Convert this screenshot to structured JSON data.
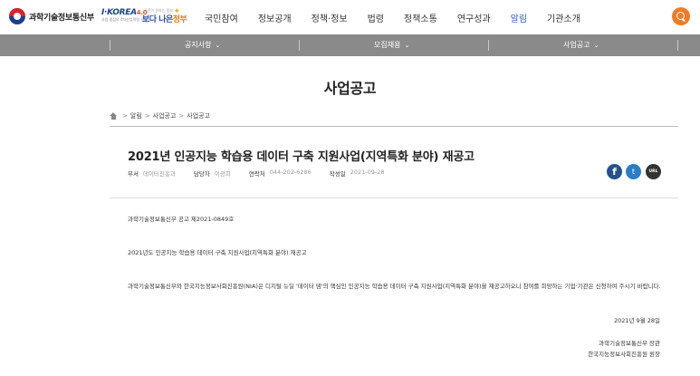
{
  "header": {
    "org_name": "과학기술정보통신부",
    "korea_logo": "I·KOREA",
    "korea_logo_suffix": "4.0",
    "korea_logo_sub": "사람 중심의 4차산업혁명 선도",
    "policy_logo_top": "국민이 원하는 정부",
    "policy_logo_prefix": "보다 나은",
    "policy_logo_main": "정부",
    "nav": [
      {
        "label": "국민참여"
      },
      {
        "label": "정보공개"
      },
      {
        "label": "정책·정보"
      },
      {
        "label": "법령"
      },
      {
        "label": "정책소통"
      },
      {
        "label": "연구성과"
      },
      {
        "label": "알림",
        "active": true
      },
      {
        "label": "기관소개"
      }
    ],
    "search_icon": "search-icon"
  },
  "subnav": {
    "items": [
      {
        "label": "공지사항"
      },
      {
        "label": "모집채용"
      },
      {
        "label": "사업공고"
      }
    ],
    "chevron": "⌄"
  },
  "page": {
    "title": "사업공고"
  },
  "breadcrumb": {
    "items": [
      "알림",
      "사업공고",
      "사업공고"
    ],
    "separator": ">"
  },
  "article": {
    "title": "2021년 인공지능 학습용 데이터 구축 지원사업(지역특화 분야) 재공고",
    "meta": {
      "dept_label": "부서",
      "dept_value": "데이터진흥과",
      "manager_label": "담당자",
      "manager_value": "이광희",
      "phone_label": "연락처",
      "phone_value": "044-202-6286",
      "date_label": "작성일",
      "date_value": "2021-09-28"
    },
    "share": {
      "facebook": "f",
      "twitter": "t",
      "url": "URL"
    },
    "body": {
      "notice_no": "과학기술정보통신부 공고 제2021-0849호",
      "subject": "2021년도 인공지능 학습용 데이터 구축 지원사업(지역특화 분야) 재공고",
      "paragraph": "과학기술정보통신부와 한국지능정보사회진흥원(NIA)은 디지털 뉴딜 '데이터 댐'의 핵심인 인공지능 학습용 데이터 구축 지원사업(지역특화 분야)을 재공고하오니 참여를 희망하는 기업·기관은 신청하여 주시기 바랍니다.",
      "date": "2021년 9월 28일",
      "signer1": "과학기술정보통신부 장관",
      "signer2": "한국지능정보사회진흥원 원장"
    }
  },
  "colors": {
    "accent_blue": "#2b5ec7",
    "search_orange": "#ef7b26",
    "subnav_gray": "#8a8a8a",
    "facebook": "#24528f",
    "twitter": "#2a7fc4"
  }
}
